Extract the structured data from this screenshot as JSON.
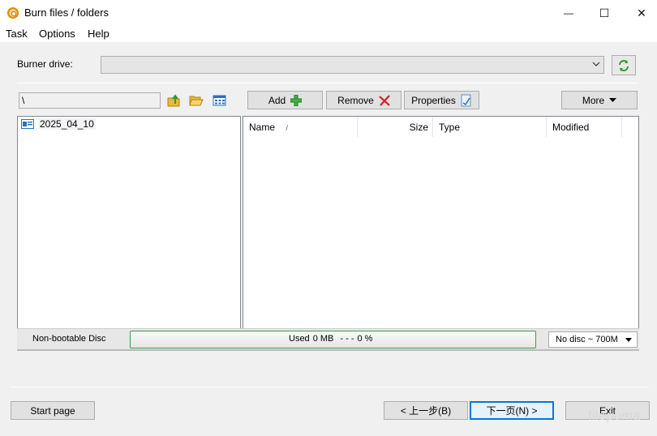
{
  "window": {
    "title": "Burn files / folders",
    "minimize_glyph": "—",
    "maximize_glyph": "☐",
    "close_glyph": "✕"
  },
  "menu": [
    "Task",
    "Options",
    "Help"
  ],
  "burner": {
    "label": "Burner drive:",
    "value": "",
    "arrow": "⌵"
  },
  "path": {
    "value": "\\"
  },
  "toolbar": {
    "add_label": "Add",
    "remove_label": "Remove",
    "properties_label": "Properties",
    "more_label": "More"
  },
  "tree": {
    "items": [
      "2025_04_10"
    ]
  },
  "columns": {
    "name": "Name",
    "sort_marker": "/",
    "size": "Size",
    "type": "Type",
    "modified": "Modified"
  },
  "status": {
    "disc_type": "Non-bootable Disc",
    "used_label": "Used",
    "used_value": "0 MB",
    "dashes": "- - -",
    "percent": "0 %",
    "progress_fraction": 0,
    "disc_capacity": "No disc ~ 700M"
  },
  "nav": {
    "start_page": "Start page",
    "back": "< 上一步(B)",
    "next": "下一页(N) >",
    "exit": "Exit"
  },
  "watermark": "filepuma",
  "colors": {
    "progress_border": "#3c9f4a",
    "accent_focus": "#0078d7"
  }
}
